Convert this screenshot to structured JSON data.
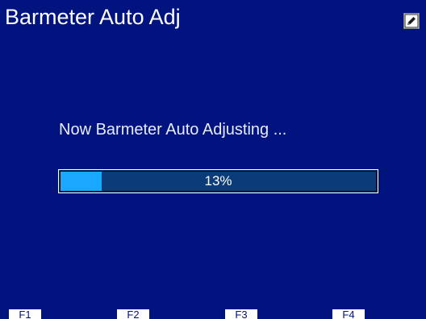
{
  "header": {
    "title": "Barmeter Auto Adj",
    "edit_icon": "edit-icon"
  },
  "main": {
    "message": "Now Barmeter Auto Adjusting ...",
    "progress": {
      "value": 13,
      "label": "13%"
    }
  },
  "function_keys": [
    {
      "label": "F1"
    },
    {
      "label": "F2"
    },
    {
      "label": "F3"
    },
    {
      "label": "F4"
    }
  ],
  "colors": {
    "background": "#00137e",
    "progress_fill": "#1aa7ff",
    "progress_track": "#0b3b78"
  }
}
